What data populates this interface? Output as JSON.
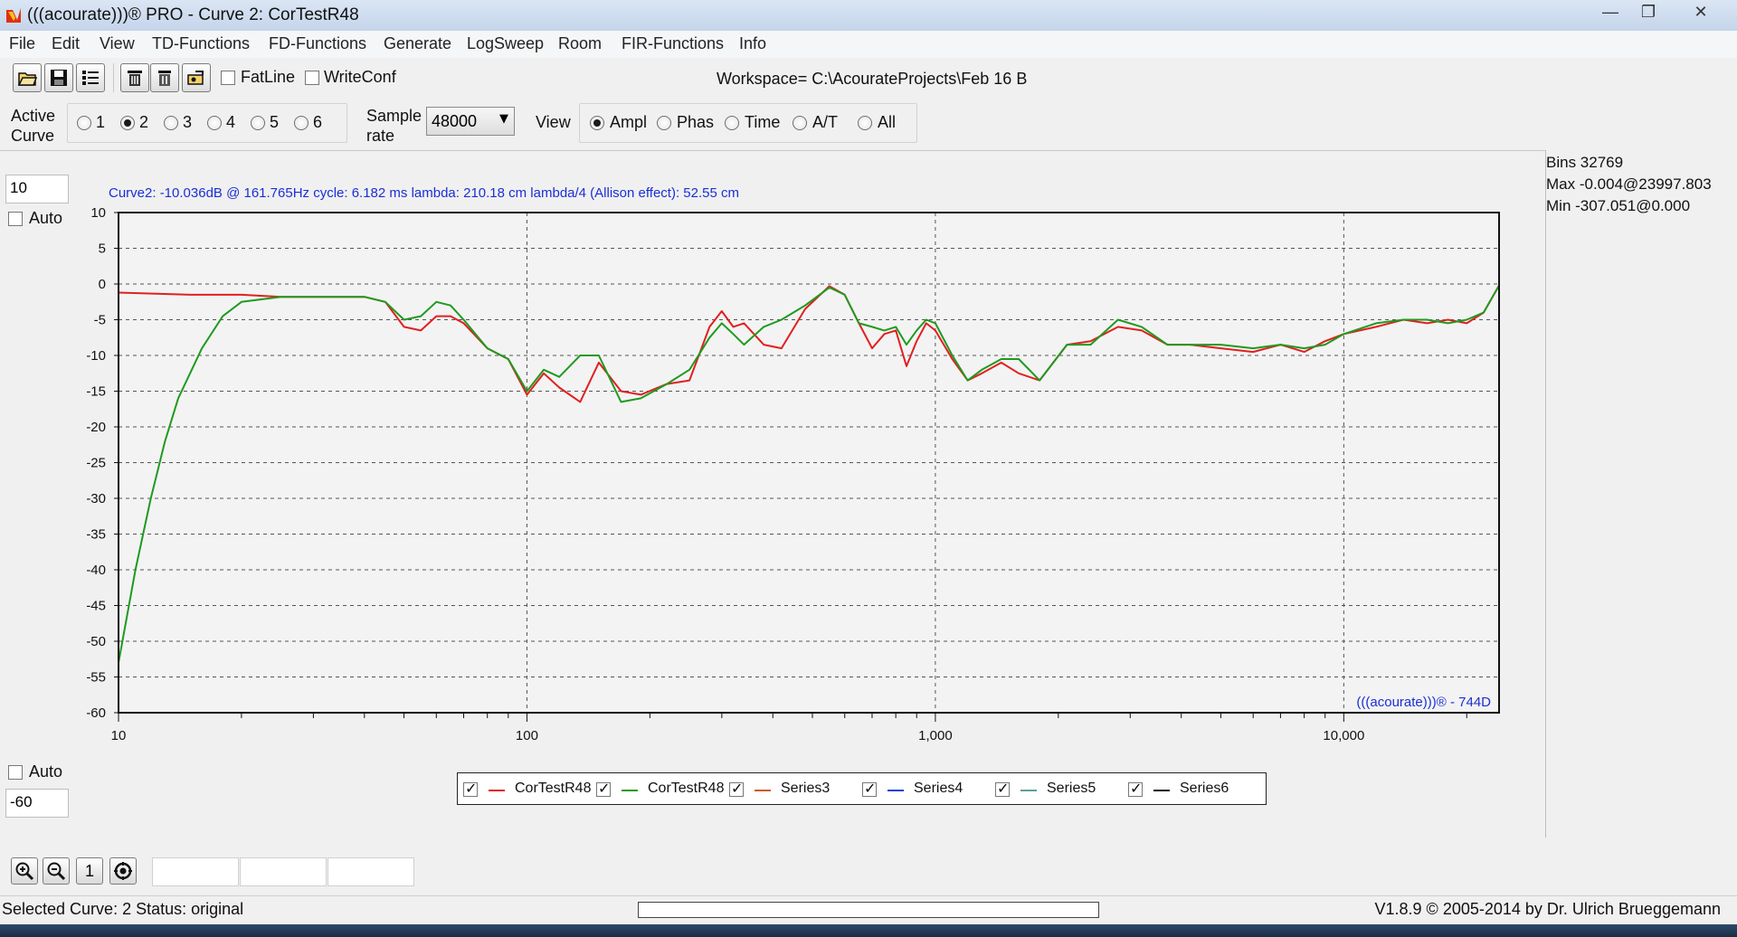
{
  "window": {
    "title": "(((acourate)))® PRO - Curve 2: CorTestR48",
    "minimize_icon": "minimize-icon",
    "maximize_icon": "restore-icon",
    "close_icon": "close-icon"
  },
  "menu": [
    "File",
    "Edit",
    "View",
    "TD-Functions",
    "FD-Functions",
    "Generate",
    "LogSweep",
    "Room",
    "FIR-Functions",
    "Info"
  ],
  "toolbar": {
    "buttons": [
      "open-folder-icon",
      "save-disk-icon",
      "list-icon",
      "delete-icon",
      "trash-icon",
      "export-icon"
    ],
    "fatline_label": "FatLine",
    "fatline_checked": false,
    "writeconf_label": "WriteConf",
    "writeconf_checked": false,
    "workspace": "Workspace= C:\\AcourateProjects\\Feb 16 B"
  },
  "controls": {
    "active_curve_label_1": "Active",
    "active_curve_label_2": "Curve",
    "curves": [
      "1",
      "2",
      "3",
      "4",
      "5",
      "6"
    ],
    "active_curve": "2",
    "sample_rate_label_1": "Sample",
    "sample_rate_label_2": "rate",
    "sample_rate": "48000",
    "view_label": "View",
    "views": [
      "Ampl",
      "Phas",
      "Time",
      "A/T",
      "All"
    ],
    "active_view": "Ampl"
  },
  "plot": {
    "y_max_input": "10",
    "y_min_input": "-60",
    "auto_label": "Auto",
    "auto_top_checked": false,
    "auto_bottom_checked": false,
    "info": "Curve2:  -10.036dB @ 161.765Hz    cycle: 6.182 ms    lambda: 210.18 cm   lambda/4 (Allison effect): 52.55 cm",
    "watermark": "(((acourate)))® - 744D"
  },
  "stats": {
    "bins": "Bins 32769",
    "max": "Max -0.004@23997.803",
    "min": "Min -307.051@0.000"
  },
  "chart_data": {
    "type": "line",
    "xscale": "log",
    "xlim": [
      10,
      24000
    ],
    "ylim": [
      -60,
      10
    ],
    "yticks": [
      10,
      5,
      0,
      -5,
      -10,
      -15,
      -20,
      -25,
      -30,
      -35,
      -40,
      -45,
      -50,
      -55,
      -60
    ],
    "xticks": [
      10,
      100,
      1000,
      10000
    ],
    "xtick_labels": [
      "10",
      "100",
      "1,000",
      "10,000"
    ],
    "grid": true,
    "series": [
      {
        "name": "CorTestR48",
        "color": "#e02020",
        "x": [
          10,
          15,
          20,
          25,
          30,
          40,
          45,
          50,
          55,
          60,
          65,
          70,
          80,
          90,
          100,
          110,
          120,
          135,
          150,
          170,
          190,
          220,
          250,
          280,
          300,
          320,
          340,
          380,
          420,
          480,
          550,
          600,
          650,
          700,
          750,
          800,
          850,
          900,
          950,
          1000,
          1100,
          1200,
          1300,
          1450,
          1600,
          1800,
          2100,
          2400,
          2800,
          3200,
          3700,
          4200,
          5000,
          6000,
          7000,
          8000,
          9000,
          10000,
          12000,
          14000,
          16000,
          18000,
          20000,
          22000,
          24000
        ],
        "y": [
          -1.2,
          -1.5,
          -1.5,
          -1.8,
          -1.8,
          -1.8,
          -2.5,
          -6,
          -6.5,
          -4.5,
          -4.5,
          -5.5,
          -9,
          -10.5,
          -15.5,
          -12.5,
          -14.5,
          -16.5,
          -11,
          -15,
          -15.5,
          -14,
          -13.5,
          -6,
          -3.8,
          -6,
          -5.5,
          -8.5,
          -9,
          -3.5,
          -0.3,
          -1.5,
          -5.5,
          -9,
          -7,
          -6.5,
          -11.5,
          -8,
          -5.5,
          -6.5,
          -10.5,
          -13.5,
          -12.5,
          -11,
          -12.5,
          -13.5,
          -8.5,
          -8,
          -6,
          -6.5,
          -8.5,
          -8.5,
          -9,
          -9.5,
          -8.5,
          -9.5,
          -8,
          -7,
          -6,
          -5,
          -5.5,
          -5,
          -5.5,
          -4,
          -0.2
        ]
      },
      {
        "name": "CorTestR48",
        "color": "#1f9a1f",
        "x": [
          10,
          11,
          12,
          13,
          14,
          16,
          18,
          20,
          25,
          30,
          40,
          45,
          50,
          55,
          60,
          65,
          70,
          80,
          90,
          100,
          110,
          120,
          135,
          150,
          170,
          190,
          220,
          250,
          280,
          300,
          320,
          340,
          380,
          420,
          480,
          550,
          600,
          650,
          700,
          750,
          800,
          850,
          900,
          950,
          1000,
          1100,
          1200,
          1300,
          1450,
          1600,
          1800,
          2100,
          2400,
          2800,
          3200,
          3700,
          4200,
          5000,
          6000,
          7000,
          8000,
          9000,
          10000,
          12000,
          14000,
          16000,
          18000,
          20000,
          22000,
          24000
        ],
        "y": [
          -53,
          -40,
          -30,
          -22,
          -16,
          -9,
          -4.5,
          -2.5,
          -1.8,
          -1.8,
          -1.8,
          -2.5,
          -5,
          -4.5,
          -2.5,
          -3,
          -5,
          -9,
          -10.5,
          -15,
          -12,
          -13,
          -10,
          -10,
          -16.5,
          -16,
          -14,
          -12,
          -7.5,
          -5.5,
          -7,
          -8.5,
          -6,
          -5,
          -3,
          -0.5,
          -1.5,
          -5.5,
          -6,
          -6.5,
          -6,
          -8.5,
          -6.5,
          -5,
          -5.5,
          -10,
          -13.5,
          -12,
          -10.5,
          -10.5,
          -13.5,
          -8.5,
          -8.5,
          -5,
          -6,
          -8.5,
          -8.5,
          -8.5,
          -9,
          -8.5,
          -9,
          -8.5,
          -7,
          -5.5,
          -5,
          -5,
          -5.5,
          -5,
          -4,
          -0.2
        ]
      }
    ],
    "legend": [
      {
        "name": "CorTestR48",
        "color": "#e02020",
        "checked": true
      },
      {
        "name": "CorTestR48",
        "color": "#1f9a1f",
        "checked": true
      },
      {
        "name": "Series3",
        "color": "#d05a1a",
        "checked": true
      },
      {
        "name": "Series4",
        "color": "#2040d0",
        "checked": true
      },
      {
        "name": "Series5",
        "color": "#5aa0a0",
        "checked": true
      },
      {
        "name": "Series6",
        "color": "#111111",
        "checked": true
      }
    ]
  },
  "bottom_tools": [
    "zoom-in-icon",
    "zoom-out-icon",
    "reset-zoom-button",
    "settings-icon"
  ],
  "reset_label": "1",
  "status": {
    "left": "Selected Curve: 2   Status: original",
    "right": "V1.8.9 © 2005-2014 by Dr. Ulrich Brueggemann"
  }
}
